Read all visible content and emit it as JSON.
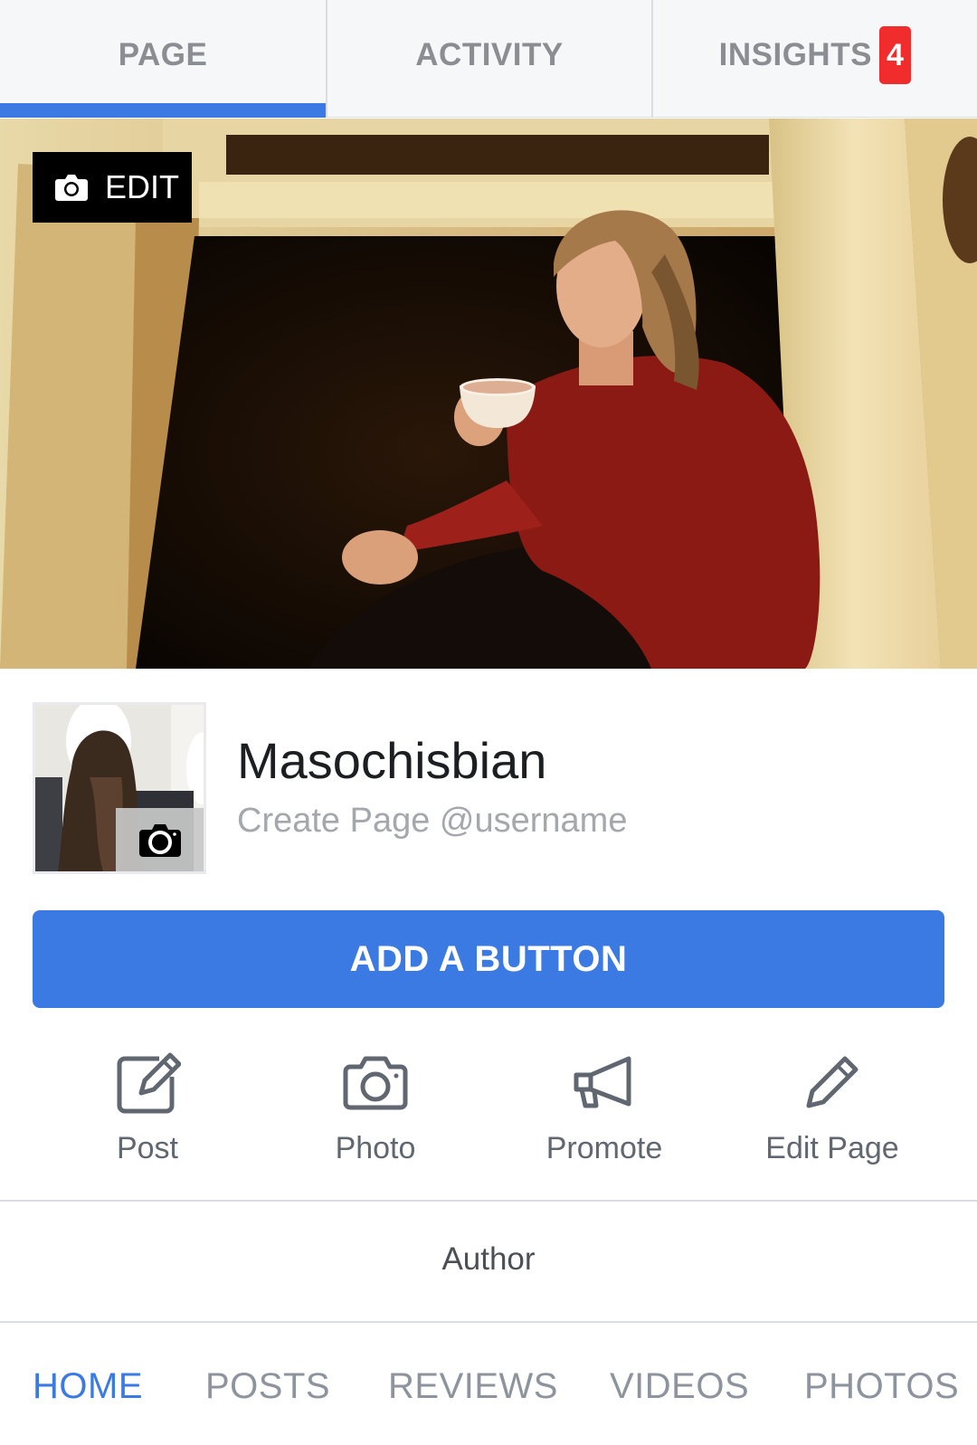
{
  "top_tabs": [
    {
      "label": "PAGE",
      "active": true
    },
    {
      "label": "ACTIVITY",
      "active": false
    },
    {
      "label": "INSIGHTS",
      "active": false,
      "badge": "4"
    }
  ],
  "cover": {
    "edit_label": "EDIT",
    "icon": "camera-icon"
  },
  "profile": {
    "name": "Masochisbian",
    "username_prompt": "Create Page @username",
    "photo_icon": "camera-icon"
  },
  "primary_button": {
    "label": "ADD A BUTTON"
  },
  "actions": [
    {
      "label": "Post",
      "icon": "compose-icon"
    },
    {
      "label": "Photo",
      "icon": "camera-icon"
    },
    {
      "label": "Promote",
      "icon": "megaphone-icon"
    },
    {
      "label": "Edit Page",
      "icon": "pencil-icon"
    }
  ],
  "category": "Author",
  "bottom_tabs": [
    {
      "label": "HOME",
      "active": true
    },
    {
      "label": "POSTS",
      "active": false
    },
    {
      "label": "REVIEWS",
      "active": false
    },
    {
      "label": "VIDEOS",
      "active": false
    },
    {
      "label": "PHOTOS",
      "active": false
    }
  ],
  "colors": {
    "accent": "#3b7ae3",
    "badge": "#f02c2c",
    "tab_text": "#8a8d91",
    "secondary_text": "#606770"
  }
}
